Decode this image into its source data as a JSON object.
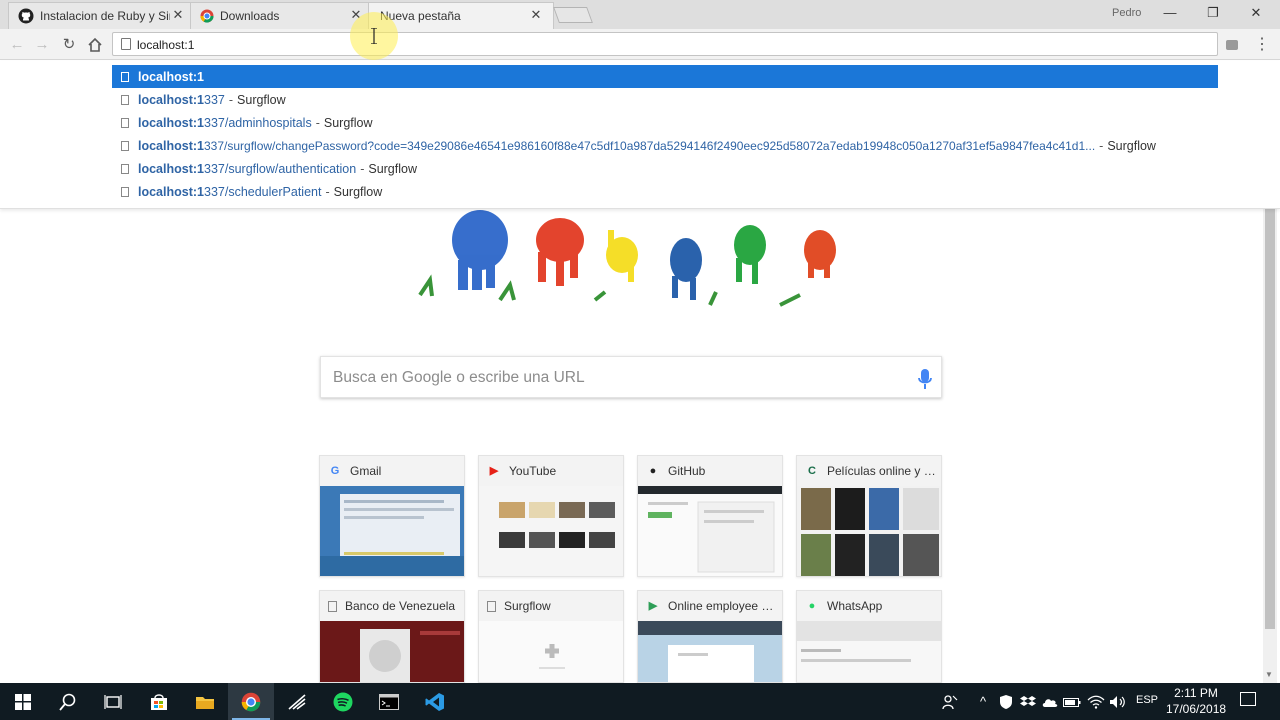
{
  "browser": {
    "tabs": [
      {
        "title": "Instalacion de Ruby y Sin",
        "icon": "github-icon",
        "active": false
      },
      {
        "title": "Downloads",
        "icon": "chrome-icon",
        "active": false
      },
      {
        "title": "Nueva pestaña",
        "icon": "none",
        "active": true
      }
    ],
    "profile": "Pedro",
    "address_value": "localhost:1"
  },
  "suggestions": [
    {
      "url_main": "localhost:1",
      "url_rest": "",
      "title": "",
      "selected": true
    },
    {
      "url_main": "localhost:1",
      "url_rest": "337",
      "sep": "-",
      "title": "Surgflow"
    },
    {
      "url_main": "localhost:1",
      "url_rest": "337/adminhospitals",
      "sep": "-",
      "title": "Surgflow"
    },
    {
      "url_main": "localhost:1",
      "url_rest": "337/surgflow/changePassword?code=349e29086e46541e986160f88e47c5df10a987da5294146f2490eec925d58072a7edab19948c050a1270af31ef5a9847fea4c41d1...",
      "sep": "-",
      "title": "Surgflow"
    },
    {
      "url_main": "localhost:1",
      "url_rest": "337/surgflow/authentication",
      "sep": "-",
      "title": "Surgflow"
    },
    {
      "url_main": "localhost:1",
      "url_rest": "337/schedulerPatient",
      "sep": "-",
      "title": "Surgflow"
    }
  ],
  "newtab": {
    "search_placeholder": "Busca en Google o escribe una URL",
    "tiles": [
      {
        "title": "Gmail",
        "icon": "google-icon",
        "fav_char": "G",
        "fav_color": "#4285f4"
      },
      {
        "title": "YouTube",
        "icon": "youtube-icon",
        "fav_char": "▶",
        "fav_color": "#e62117"
      },
      {
        "title": "GitHub",
        "icon": "github-icon",
        "fav_char": "●",
        "fav_color": "#222222"
      },
      {
        "title": "Películas online y p...",
        "icon": "cuevana-icon",
        "fav_char": "C",
        "fav_color": "#1a6e4a"
      },
      {
        "title": "Banco de Venezuela",
        "icon": "page-icon",
        "fav_char": "",
        "fav_color": "#888888"
      },
      {
        "title": "Surgflow",
        "icon": "page-icon",
        "fav_char": "",
        "fav_color": "#888888"
      },
      {
        "title": "Online employee m...",
        "icon": "play-icon",
        "fav_char": "▶",
        "fav_color": "#2e9e57"
      },
      {
        "title": "WhatsApp",
        "icon": "whatsapp-icon",
        "fav_char": "●",
        "fav_color": "#25d366"
      }
    ]
  },
  "taskbar": {
    "language": "ESP",
    "time": "2:11 PM",
    "date": "17/06/2018"
  }
}
